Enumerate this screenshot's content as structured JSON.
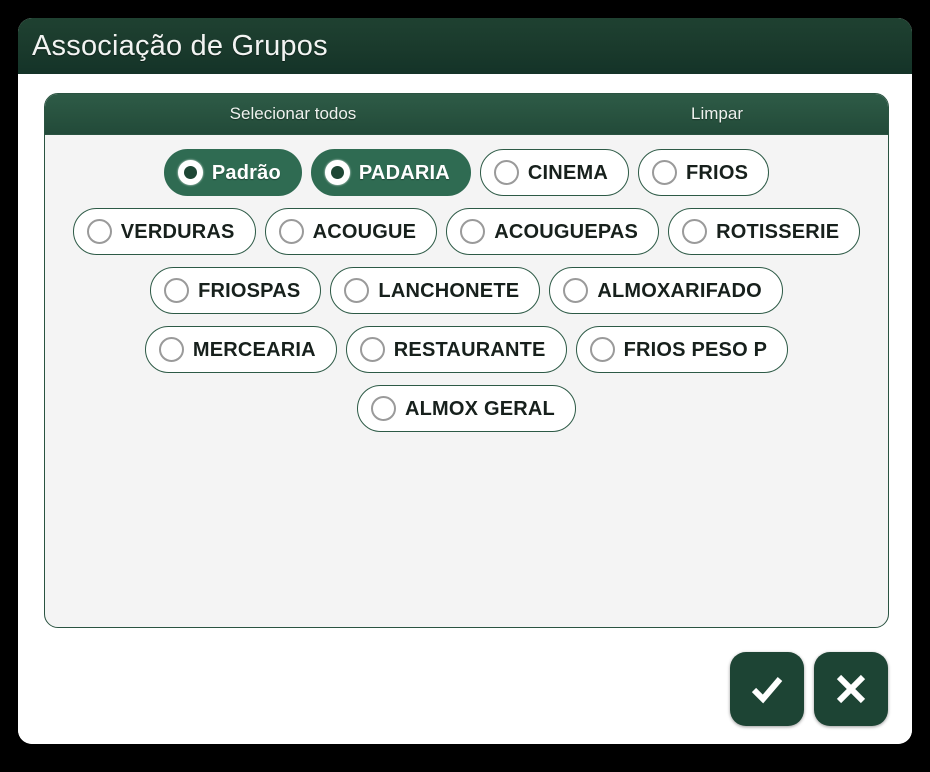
{
  "window": {
    "title": "Associação de Grupos"
  },
  "panel": {
    "header": {
      "select_all_label": "Selecionar todos",
      "clear_label": "Limpar"
    },
    "rows": [
      [
        {
          "label": "Padrão",
          "selected": true
        },
        {
          "label": "PADARIA",
          "selected": true
        },
        {
          "label": "CINEMA",
          "selected": false
        },
        {
          "label": "FRIOS",
          "selected": false
        }
      ],
      [
        {
          "label": "VERDURAS",
          "selected": false
        },
        {
          "label": "ACOUGUE",
          "selected": false
        },
        {
          "label": "ACOUGUEPAS",
          "selected": false
        },
        {
          "label": "ROTISSERIE",
          "selected": false
        }
      ],
      [
        {
          "label": "FRIOSPAS",
          "selected": false
        },
        {
          "label": "LANCHONETE",
          "selected": false
        },
        {
          "label": "ALMOXARIFADO",
          "selected": false
        }
      ],
      [
        {
          "label": "MERCEARIA",
          "selected": false
        },
        {
          "label": "RESTAURANTE",
          "selected": false
        },
        {
          "label": "FRIOS PESO P",
          "selected": false
        }
      ],
      [
        {
          "label": "ALMOX GERAL",
          "selected": false
        }
      ]
    ]
  },
  "footer": {
    "confirm_icon": "check-icon",
    "cancel_icon": "close-icon"
  },
  "colors": {
    "titlebar_green": "#1a3a2c",
    "header_green": "#27513e",
    "chip_selected_green": "#2f6b52",
    "button_green": "#1d4434",
    "panel_background": "#f4f4f4"
  }
}
